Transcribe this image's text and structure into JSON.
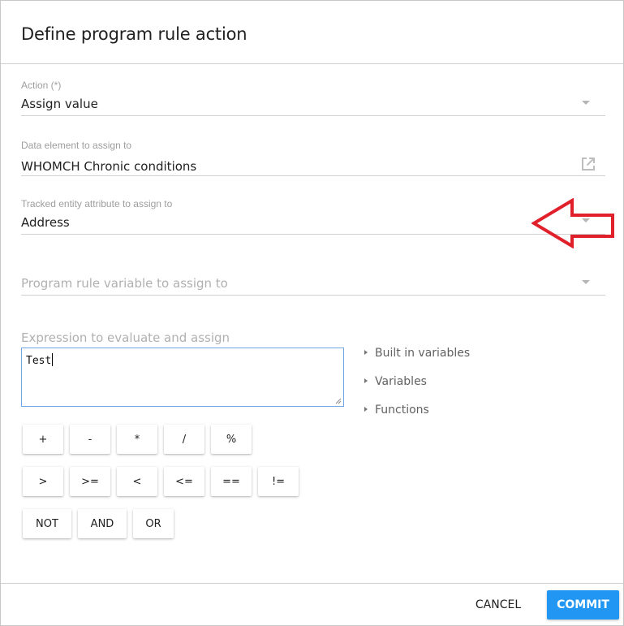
{
  "dialog": {
    "title": "Define program rule action"
  },
  "fields": {
    "action": {
      "label": "Action (*)",
      "value": "Assign value"
    },
    "data_element": {
      "label": "Data element to assign to",
      "value": "WHOMCH Chronic conditions"
    },
    "tracked_entity": {
      "label": "Tracked entity attribute to assign to",
      "value": "Address"
    },
    "program_rule_variable": {
      "placeholder": "Program rule variable to assign to"
    }
  },
  "expression": {
    "label": "Expression to evaluate and assign",
    "value": "Test"
  },
  "side_links": {
    "built_in": "Built in variables",
    "variables": "Variables",
    "functions": "Functions"
  },
  "operators": {
    "row1": [
      "+",
      "-",
      "*",
      "/",
      "%"
    ],
    "row2": [
      ">",
      ">=",
      "<",
      "<=",
      "==",
      "!="
    ],
    "row3": [
      "NOT",
      "AND",
      "OR"
    ]
  },
  "footer": {
    "cancel": "CANCEL",
    "commit": "COMMIT"
  },
  "colors": {
    "accent": "#2196f3",
    "annotation_arrow": "#e0202a"
  }
}
